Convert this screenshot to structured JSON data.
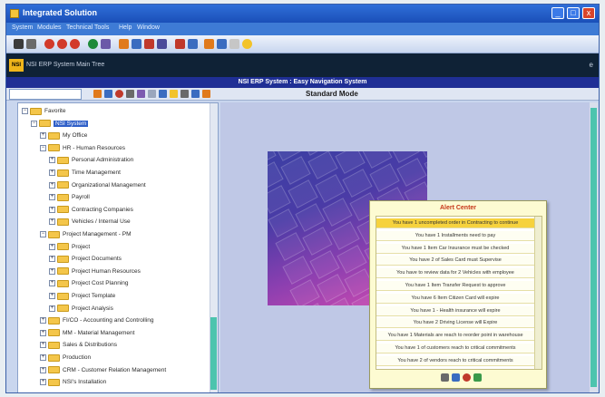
{
  "window": {
    "title": "Integrated Solution",
    "controls": [
      "_",
      "□",
      "x"
    ]
  },
  "menu": [
    {
      "label": "System"
    },
    {
      "label": "Modules"
    },
    {
      "label": "Technical Tools"
    },
    {
      "label": "Help"
    },
    {
      "label": "Window"
    }
  ],
  "header": {
    "logo_text": "NSI",
    "subtitle": "NSI ERP System Main Tree",
    "corner": "e"
  },
  "banner": {
    "text": "NSI ERP System : Easy Navigation System"
  },
  "toolbar2": {
    "search_placeholder": "",
    "mode": "Standard Mode"
  },
  "tree": {
    "items": [
      {
        "label": "Favorite",
        "level": 0,
        "toggle": "−"
      },
      {
        "label": "NSI System",
        "level": 1,
        "toggle": "−",
        "selected": true
      },
      {
        "label": "My Office",
        "level": 2,
        "toggle": "+"
      },
      {
        "label": "HR - Human Resources",
        "level": 2,
        "toggle": "−"
      },
      {
        "label": "Personal Administration",
        "level": 3,
        "toggle": "+"
      },
      {
        "label": "Time Management",
        "level": 3,
        "toggle": "+"
      },
      {
        "label": "Organizational Management",
        "level": 3,
        "toggle": "+"
      },
      {
        "label": "Payroll",
        "level": 3,
        "toggle": "+"
      },
      {
        "label": "Contracting Companies",
        "level": 3,
        "toggle": "+"
      },
      {
        "label": "Vehicles / Internal Use",
        "level": 3,
        "toggle": "+"
      },
      {
        "label": "Project Management - PM",
        "level": 2,
        "toggle": "−"
      },
      {
        "label": "Project",
        "level": 3,
        "toggle": "+"
      },
      {
        "label": "Project Documents",
        "level": 3,
        "toggle": "+"
      },
      {
        "label": "Project Human Resources",
        "level": 3,
        "toggle": "+"
      },
      {
        "label": "Project Cost Planning",
        "level": 3,
        "toggle": "+"
      },
      {
        "label": "Project Template",
        "level": 3,
        "toggle": "+"
      },
      {
        "label": "Project Analysis",
        "level": 3,
        "toggle": "+"
      },
      {
        "label": "FI/CO - Accounting and Controlling",
        "level": 2,
        "toggle": "+"
      },
      {
        "label": "MM - Material Management",
        "level": 2,
        "toggle": "+"
      },
      {
        "label": "Sales & Distributions",
        "level": 2,
        "toggle": "+"
      },
      {
        "label": "Production",
        "level": 2,
        "toggle": "+"
      },
      {
        "label": "CRM - Customer Relation Management",
        "level": 2,
        "toggle": "+"
      },
      {
        "label": "NSI's Installation",
        "level": 2,
        "toggle": "+"
      }
    ]
  },
  "alert": {
    "title": "Alert Center",
    "items": [
      "You have 1 uncompleted order in Contracting to continue",
      "You have 1 Installments need to pay",
      "You have 1 Item Car Insurance must be checked",
      "You have 2 of Sales Card must Supervise",
      "You have to review data for 2 Vehicles with employee",
      "You have 1 Item Transfer Request to approve",
      "You have 6 Item Citizen Card will expire",
      "You have 1 - Health insurance will expire",
      "You have 2 Driving License will Expire",
      "You have 1 Materials are reach to reorder point in warehouse",
      "You have 1 of customers reach to critical commitments",
      "You have 2 of vendors reach to critical commitments"
    ],
    "highlight_index": 0
  },
  "colors": {
    "titlebar": "#1a4fb8",
    "banner": "#1f2f95",
    "alert_title": "#c63518",
    "accent_scroll": "#4cc4ae"
  }
}
